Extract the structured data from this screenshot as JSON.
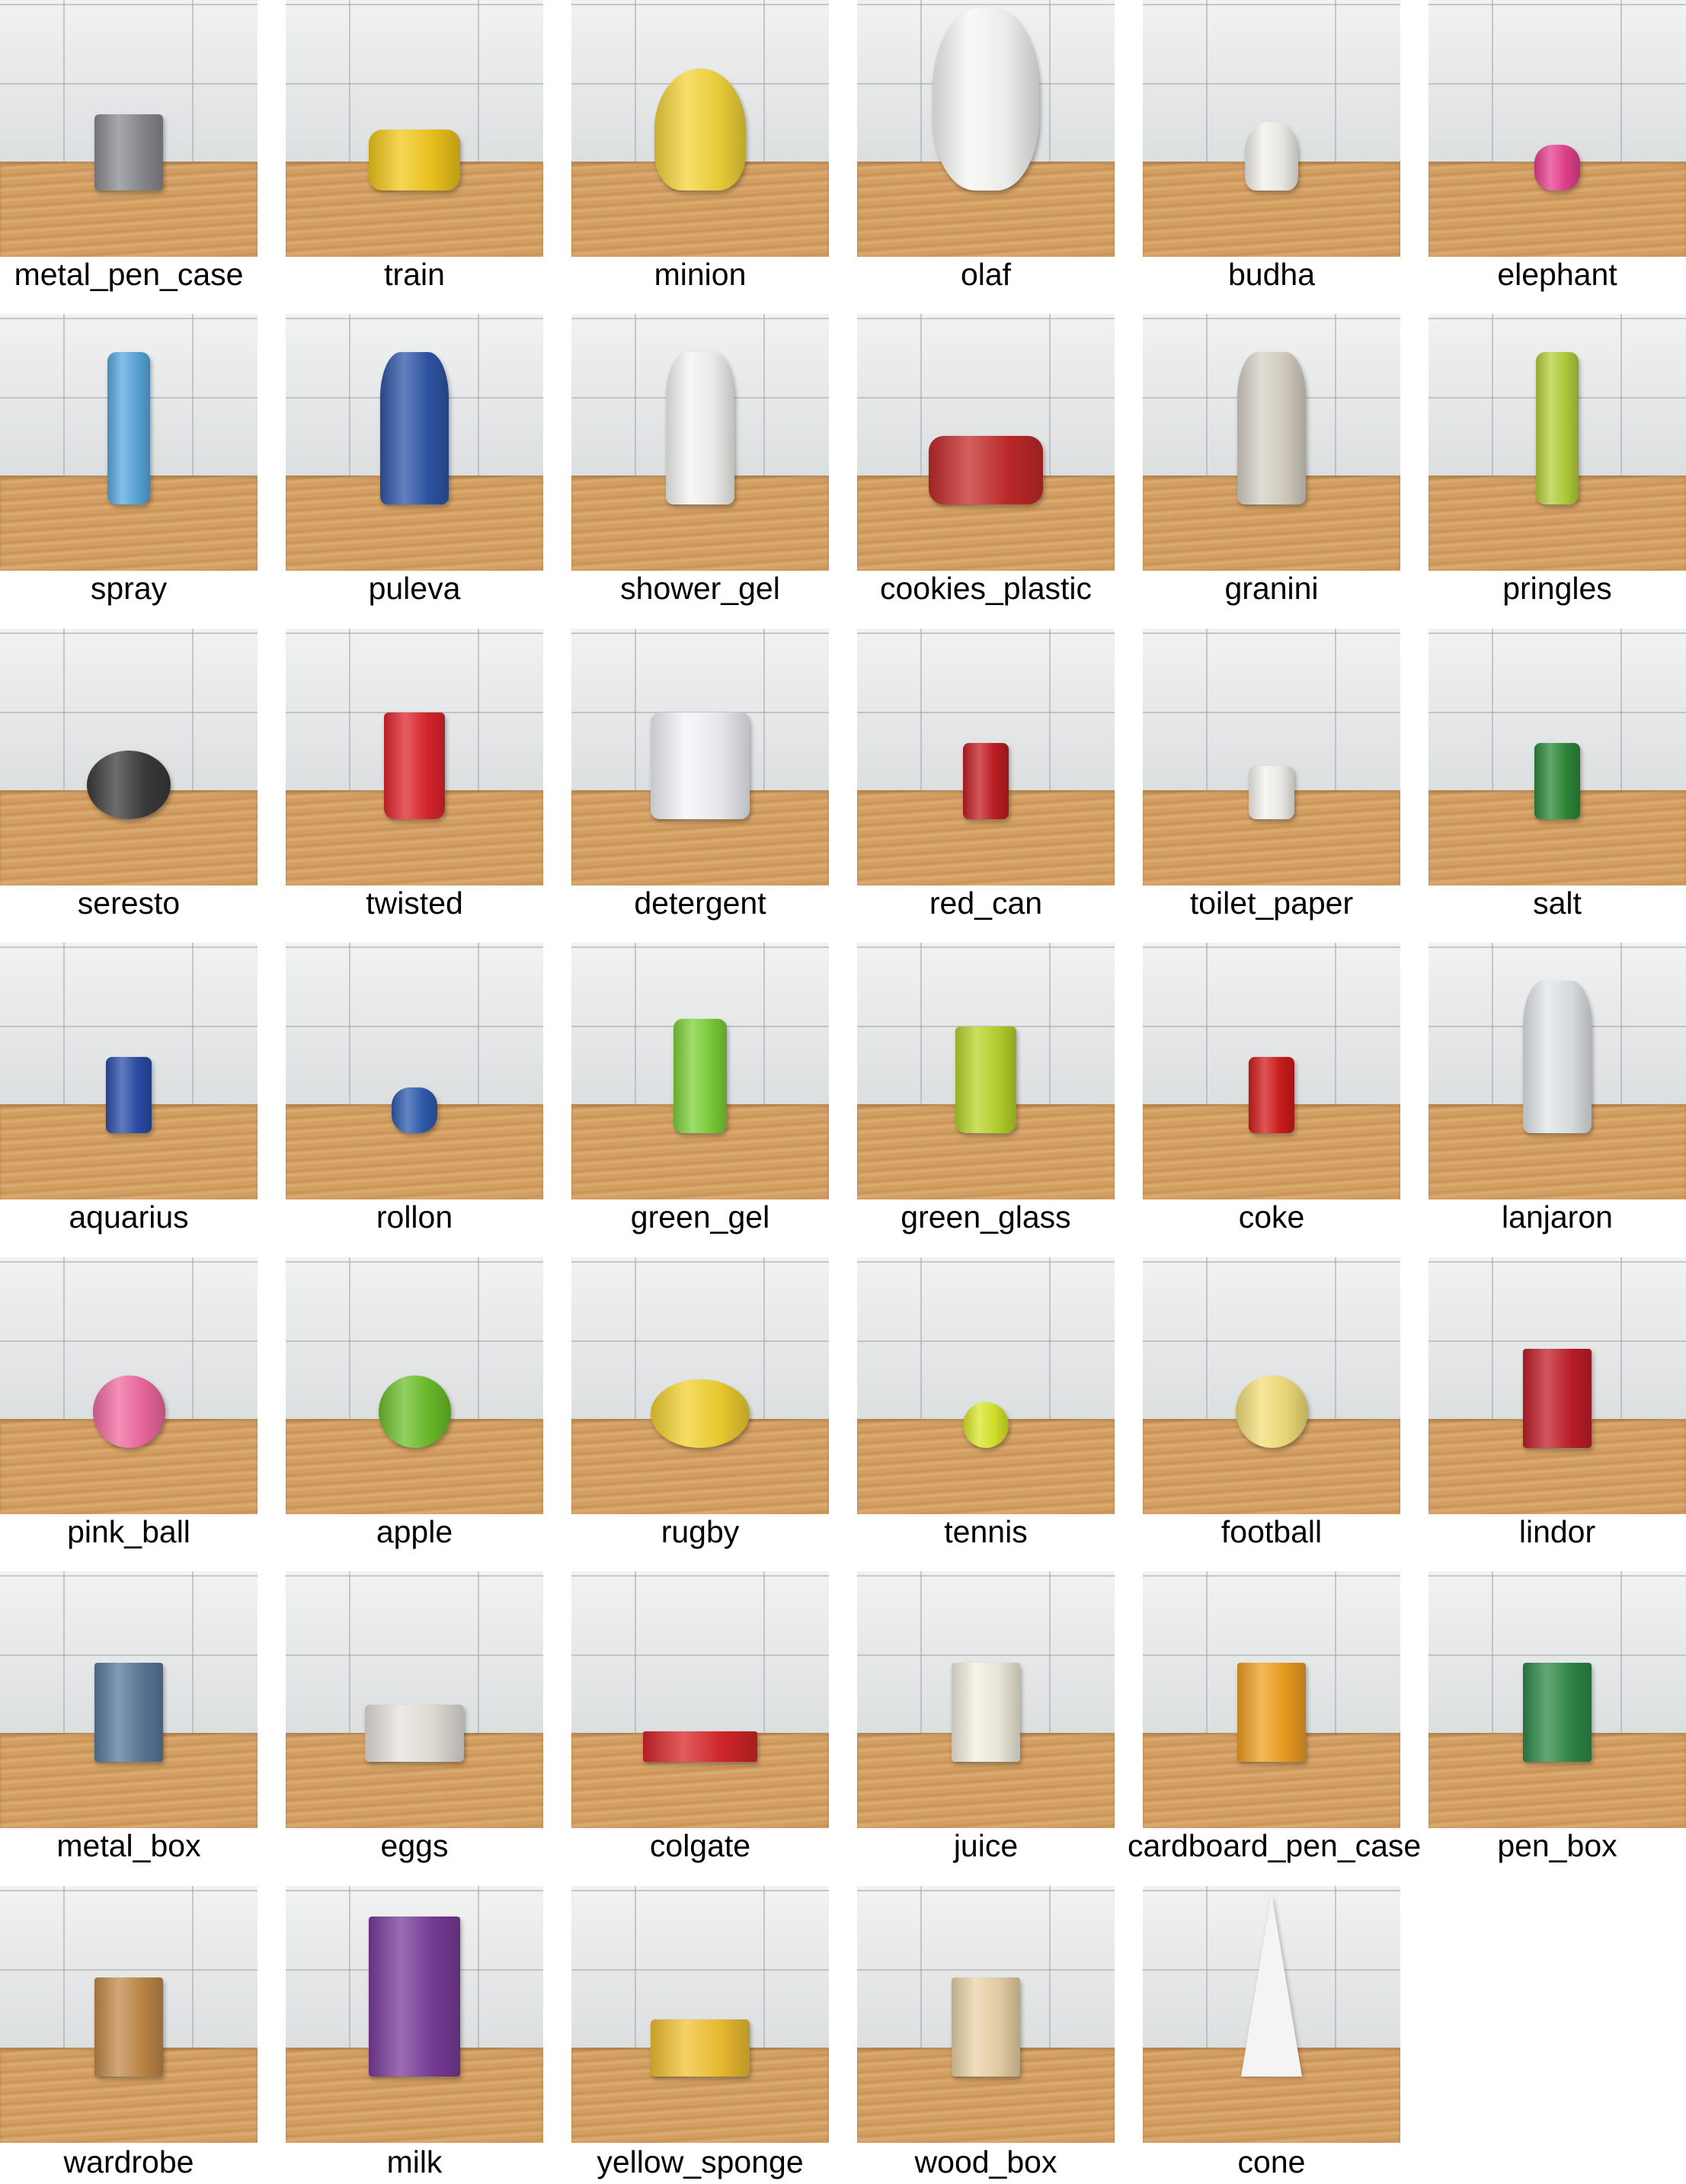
{
  "objects": [
    {
      "label": "metal_pen_case",
      "shape": "basket",
      "color": "#8a8c90"
    },
    {
      "label": "train",
      "shape": "toy",
      "color": "#f2c81c"
    },
    {
      "label": "minion",
      "shape": "plush",
      "color": "#f4d53a"
    },
    {
      "label": "olaf",
      "shape": "snowman",
      "color": "#f7f7f5"
    },
    {
      "label": "budha",
      "shape": "figurine",
      "color": "#f3f1ec"
    },
    {
      "label": "elephant",
      "shape": "small",
      "color": "#e6408e"
    },
    {
      "label": "spray",
      "shape": "tall-can",
      "color": "#5aa9e0"
    },
    {
      "label": "puleva",
      "shape": "bottle",
      "color": "#2f56a8"
    },
    {
      "label": "shower_gel",
      "shape": "bottle",
      "color": "#f5f5f2"
    },
    {
      "label": "cookies_plastic",
      "shape": "tin",
      "color": "#c42a2a"
    },
    {
      "label": "granini",
      "shape": "bottle",
      "color": "#d8d2c6"
    },
    {
      "label": "pringles",
      "shape": "tall-can",
      "color": "#b5d13c"
    },
    {
      "label": "seresto",
      "shape": "disc",
      "color": "#3b3b3b"
    },
    {
      "label": "twisted",
      "shape": "cup",
      "color": "#e0262d"
    },
    {
      "label": "detergent",
      "shape": "tub",
      "color": "#f2f4f7"
    },
    {
      "label": "red_can",
      "shape": "can",
      "color": "#c21e22"
    },
    {
      "label": "toilet_paper",
      "shape": "roll",
      "color": "#f5f3ee"
    },
    {
      "label": "salt",
      "shape": "can",
      "color": "#2e8a3a"
    },
    {
      "label": "aquarius",
      "shape": "can",
      "color": "#2a4ea8"
    },
    {
      "label": "rollon",
      "shape": "small",
      "color": "#2d5cb0"
    },
    {
      "label": "green_gel",
      "shape": "dispenser",
      "color": "#7ed13a"
    },
    {
      "label": "green_glass",
      "shape": "cup",
      "color": "#b8d62c"
    },
    {
      "label": "coke",
      "shape": "can",
      "color": "#d21c1c"
    },
    {
      "label": "lanjaron",
      "shape": "bottle",
      "color": "#e2e6e8"
    },
    {
      "label": "pink_ball",
      "shape": "ball",
      "color": "#f06aa0"
    },
    {
      "label": "apple",
      "shape": "ball",
      "color": "#6cc02a"
    },
    {
      "label": "rugby",
      "shape": "oval",
      "color": "#f2d230"
    },
    {
      "label": "tennis",
      "shape": "small-ball",
      "color": "#d8e82a"
    },
    {
      "label": "football",
      "shape": "ball",
      "color": "#f3e07a"
    },
    {
      "label": "lindor",
      "shape": "box",
      "color": "#c21e2a"
    },
    {
      "label": "metal_box",
      "shape": "box",
      "color": "#5a7a9a"
    },
    {
      "label": "eggs",
      "shape": "flat-box",
      "color": "#e6e3dc"
    },
    {
      "label": "colgate",
      "shape": "long-box",
      "color": "#d8262a"
    },
    {
      "label": "juice",
      "shape": "box",
      "color": "#f3f0e0"
    },
    {
      "label": "cardboard_pen_case",
      "shape": "box",
      "color": "#f0a020"
    },
    {
      "label": "pen_box",
      "shape": "box",
      "color": "#2f8a4a"
    },
    {
      "label": "wardrobe",
      "shape": "box",
      "color": "#c28a4a"
    },
    {
      "label": "milk",
      "shape": "carton",
      "color": "#7a3c9a"
    },
    {
      "label": "yellow_sponge",
      "shape": "flat-box",
      "color": "#f2c234"
    },
    {
      "label": "wood_box",
      "shape": "box",
      "color": "#ead4a8"
    },
    {
      "label": "cone",
      "shape": "cone",
      "color": "#f4f4f4"
    }
  ]
}
